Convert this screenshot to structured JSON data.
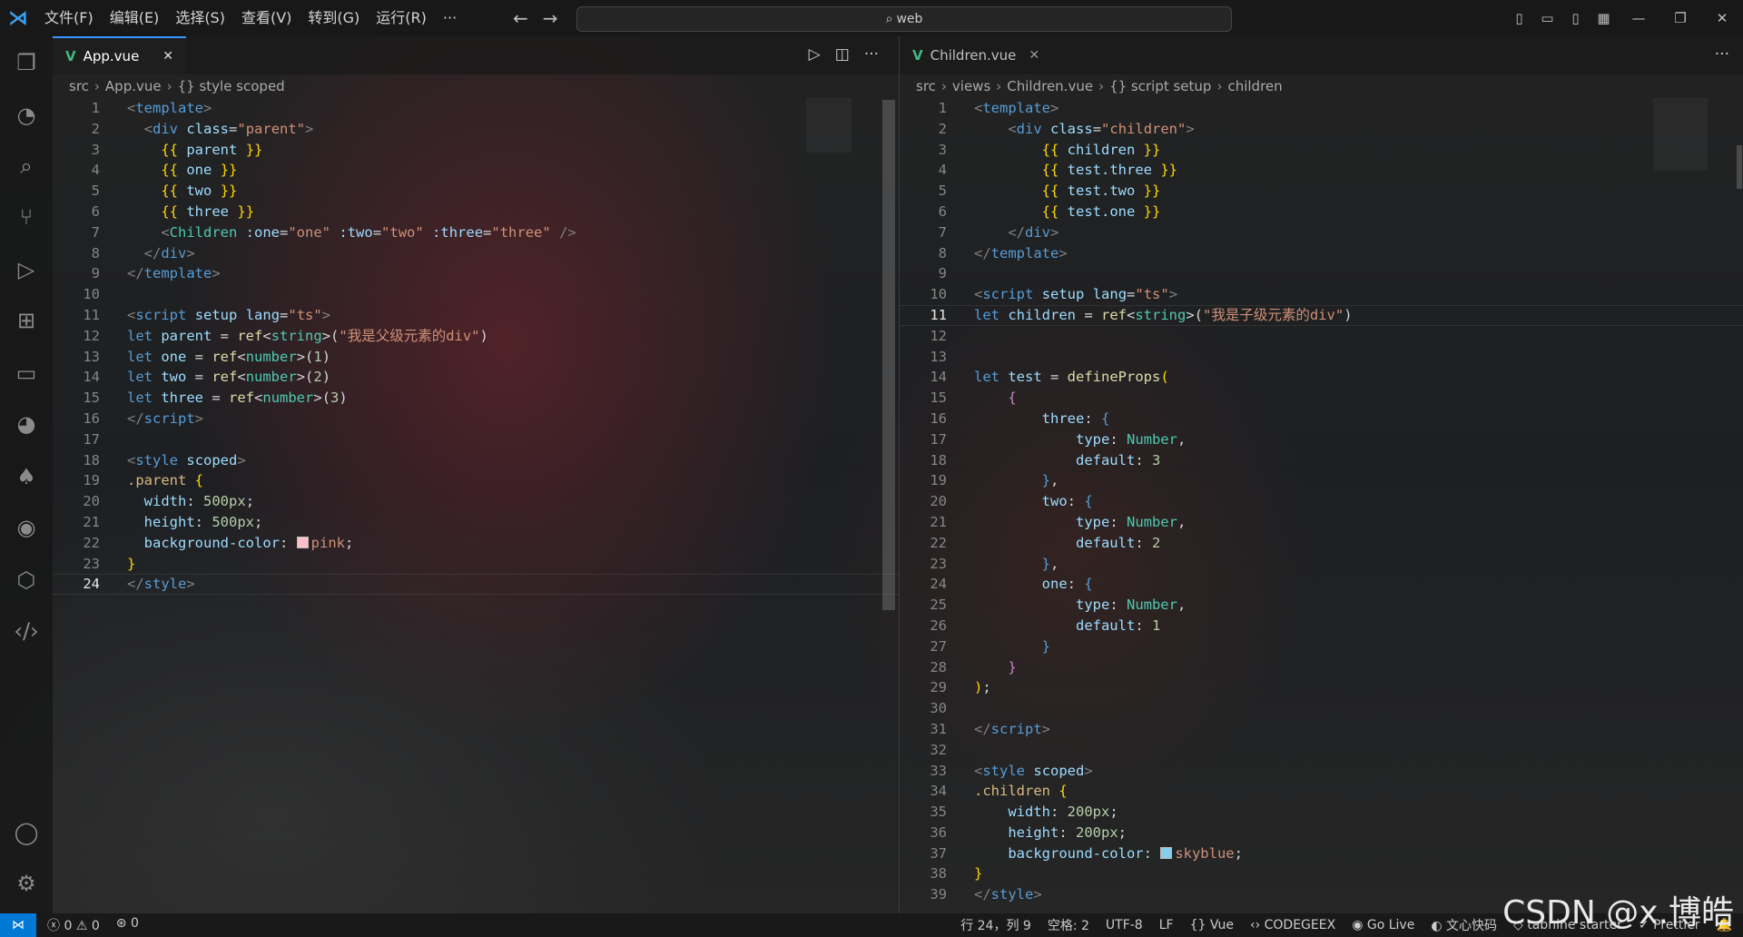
{
  "app": {
    "logo": "vscode-logo-icon"
  },
  "menu": [
    "文件(F)",
    "编辑(E)",
    "选择(S)",
    "查看(V)",
    "转到(G)",
    "运行(R)",
    "···"
  ],
  "search": {
    "text": "web"
  },
  "left_editor": {
    "tab": {
      "label": "App.vue",
      "close": "✕"
    },
    "breadcrumb": [
      "src",
      "App.vue",
      "{} style scoped"
    ],
    "current_line": 24,
    "lines": [
      [
        [
          "t-tag",
          "<"
        ],
        [
          "t-el",
          "template"
        ],
        [
          "t-tag",
          ">"
        ]
      ],
      [
        [
          "t-plain",
          "  "
        ],
        [
          "t-tag",
          "<"
        ],
        [
          "t-el",
          "div"
        ],
        [
          "t-plain",
          " "
        ],
        [
          "t-attr",
          "class"
        ],
        [
          "t-plain",
          "="
        ],
        [
          "t-str",
          "\"parent\""
        ],
        [
          "t-tag",
          ">"
        ]
      ],
      [
        [
          "t-plain",
          "    "
        ],
        [
          "t-brace",
          "{{"
        ],
        [
          "t-plain",
          " "
        ],
        [
          "t-var",
          "parent"
        ],
        [
          "t-plain",
          " "
        ],
        [
          "t-brace",
          "}}"
        ]
      ],
      [
        [
          "t-plain",
          "    "
        ],
        [
          "t-brace",
          "{{"
        ],
        [
          "t-plain",
          " "
        ],
        [
          "t-var",
          "one"
        ],
        [
          "t-plain",
          " "
        ],
        [
          "t-brace",
          "}}"
        ]
      ],
      [
        [
          "t-plain",
          "    "
        ],
        [
          "t-brace",
          "{{"
        ],
        [
          "t-plain",
          " "
        ],
        [
          "t-var",
          "two"
        ],
        [
          "t-plain",
          " "
        ],
        [
          "t-brace",
          "}}"
        ]
      ],
      [
        [
          "t-plain",
          "    "
        ],
        [
          "t-brace",
          "{{"
        ],
        [
          "t-plain",
          " "
        ],
        [
          "t-var",
          "three"
        ],
        [
          "t-plain",
          " "
        ],
        [
          "t-brace",
          "}}"
        ]
      ],
      [
        [
          "t-plain",
          "    "
        ],
        [
          "t-tag",
          "<"
        ],
        [
          "t-comp",
          "Children"
        ],
        [
          "t-plain",
          " "
        ],
        [
          "t-attr",
          ":one"
        ],
        [
          "t-plain",
          "="
        ],
        [
          "t-str",
          "\"one\""
        ],
        [
          "t-plain",
          " "
        ],
        [
          "t-attr",
          ":two"
        ],
        [
          "t-plain",
          "="
        ],
        [
          "t-str",
          "\"two\""
        ],
        [
          "t-plain",
          " "
        ],
        [
          "t-attr",
          ":three"
        ],
        [
          "t-plain",
          "="
        ],
        [
          "t-str",
          "\"three\""
        ],
        [
          "t-plain",
          " "
        ],
        [
          "t-tag",
          "/>"
        ]
      ],
      [
        [
          "t-plain",
          "  "
        ],
        [
          "t-tag",
          "</"
        ],
        [
          "t-el",
          "div"
        ],
        [
          "t-tag",
          ">"
        ]
      ],
      [
        [
          "t-tag",
          "</"
        ],
        [
          "t-el",
          "template"
        ],
        [
          "t-tag",
          ">"
        ]
      ],
      [],
      [
        [
          "t-tag",
          "<"
        ],
        [
          "t-el",
          "script"
        ],
        [
          "t-plain",
          " "
        ],
        [
          "t-attr",
          "setup"
        ],
        [
          "t-plain",
          " "
        ],
        [
          "t-attr",
          "lang"
        ],
        [
          "t-plain",
          "="
        ],
        [
          "t-str",
          "\"ts\""
        ],
        [
          "t-tag",
          ">"
        ]
      ],
      [
        [
          "t-kw",
          "let"
        ],
        [
          "t-plain",
          " "
        ],
        [
          "t-var",
          "parent"
        ],
        [
          "t-plain",
          " = "
        ],
        [
          "t-fn",
          "ref"
        ],
        [
          "t-plain",
          "<"
        ],
        [
          "t-type",
          "string"
        ],
        [
          "t-plain",
          ">("
        ],
        [
          "t-str",
          "\"我是父级元素的div\""
        ],
        [
          "t-plain",
          ")"
        ]
      ],
      [
        [
          "t-kw",
          "let"
        ],
        [
          "t-plain",
          " "
        ],
        [
          "t-var",
          "one"
        ],
        [
          "t-plain",
          " = "
        ],
        [
          "t-fn",
          "ref"
        ],
        [
          "t-plain",
          "<"
        ],
        [
          "t-type",
          "number"
        ],
        [
          "t-plain",
          ">("
        ],
        [
          "t-num",
          "1"
        ],
        [
          "t-plain",
          ")"
        ]
      ],
      [
        [
          "t-kw",
          "let"
        ],
        [
          "t-plain",
          " "
        ],
        [
          "t-var",
          "two"
        ],
        [
          "t-plain",
          " = "
        ],
        [
          "t-fn",
          "ref"
        ],
        [
          "t-plain",
          "<"
        ],
        [
          "t-type",
          "number"
        ],
        [
          "t-plain",
          ">("
        ],
        [
          "t-num",
          "2"
        ],
        [
          "t-plain",
          ")"
        ]
      ],
      [
        [
          "t-kw",
          "let"
        ],
        [
          "t-plain",
          " "
        ],
        [
          "t-var",
          "three"
        ],
        [
          "t-plain",
          " = "
        ],
        [
          "t-fn",
          "ref"
        ],
        [
          "t-plain",
          "<"
        ],
        [
          "t-type",
          "number"
        ],
        [
          "t-plain",
          ">("
        ],
        [
          "t-num",
          "3"
        ],
        [
          "t-plain",
          ")"
        ]
      ],
      [
        [
          "t-tag",
          "</"
        ],
        [
          "t-el",
          "script"
        ],
        [
          "t-tag",
          ">"
        ]
      ],
      [],
      [
        [
          "t-tag",
          "<"
        ],
        [
          "t-el",
          "style"
        ],
        [
          "t-plain",
          " "
        ],
        [
          "t-attr",
          "scoped"
        ],
        [
          "t-tag",
          ">"
        ]
      ],
      [
        [
          "t-cls",
          ".parent"
        ],
        [
          "t-plain",
          " "
        ],
        [
          "t-brace",
          "{"
        ]
      ],
      [
        [
          "t-plain",
          "  "
        ],
        [
          "t-attr",
          "width"
        ],
        [
          "t-plain",
          ": "
        ],
        [
          "t-num",
          "500px"
        ],
        [
          "t-plain",
          ";"
        ]
      ],
      [
        [
          "t-plain",
          "  "
        ],
        [
          "t-attr",
          "height"
        ],
        [
          "t-plain",
          ": "
        ],
        [
          "t-num",
          "500px"
        ],
        [
          "t-plain",
          ";"
        ]
      ],
      [
        [
          "t-plain",
          "  "
        ],
        [
          "t-attr",
          "background-color"
        ],
        [
          "t-plain",
          ": "
        ],
        [
          "swatch",
          "#ffc0cb"
        ],
        [
          "t-str",
          "pink"
        ],
        [
          "t-plain",
          ";"
        ]
      ],
      [
        [
          "t-brace",
          "}"
        ]
      ],
      [
        [
          "t-tag",
          "</"
        ],
        [
          "t-el",
          "style"
        ],
        [
          "t-tag",
          ">"
        ]
      ]
    ]
  },
  "right_editor": {
    "tab": {
      "label": "Children.vue",
      "close": "✕"
    },
    "breadcrumb": [
      "src",
      "views",
      "Children.vue",
      "{} script setup",
      "children"
    ],
    "current_line": 11,
    "lines": [
      [
        [
          "t-tag",
          "<"
        ],
        [
          "t-el",
          "template"
        ],
        [
          "t-tag",
          ">"
        ]
      ],
      [
        [
          "t-plain",
          "    "
        ],
        [
          "t-tag",
          "<"
        ],
        [
          "t-el",
          "div"
        ],
        [
          "t-plain",
          " "
        ],
        [
          "t-attr",
          "class"
        ],
        [
          "t-plain",
          "="
        ],
        [
          "t-str",
          "\"children\""
        ],
        [
          "t-tag",
          ">"
        ]
      ],
      [
        [
          "t-plain",
          "        "
        ],
        [
          "t-brace",
          "{{"
        ],
        [
          "t-plain",
          " "
        ],
        [
          "t-var",
          "children"
        ],
        [
          "t-plain",
          " "
        ],
        [
          "t-brace",
          "}}"
        ]
      ],
      [
        [
          "t-plain",
          "        "
        ],
        [
          "t-brace",
          "{{"
        ],
        [
          "t-plain",
          " "
        ],
        [
          "t-var",
          "test.three"
        ],
        [
          "t-plain",
          " "
        ],
        [
          "t-brace",
          "}}"
        ]
      ],
      [
        [
          "t-plain",
          "        "
        ],
        [
          "t-brace",
          "{{"
        ],
        [
          "t-plain",
          " "
        ],
        [
          "t-var",
          "test.two"
        ],
        [
          "t-plain",
          " "
        ],
        [
          "t-brace",
          "}}"
        ]
      ],
      [
        [
          "t-plain",
          "        "
        ],
        [
          "t-brace",
          "{{"
        ],
        [
          "t-plain",
          " "
        ],
        [
          "t-var",
          "test.one"
        ],
        [
          "t-plain",
          " "
        ],
        [
          "t-brace",
          "}}"
        ]
      ],
      [
        [
          "t-plain",
          "    "
        ],
        [
          "t-tag",
          "</"
        ],
        [
          "t-el",
          "div"
        ],
        [
          "t-tag",
          ">"
        ]
      ],
      [
        [
          "t-tag",
          "</"
        ],
        [
          "t-el",
          "template"
        ],
        [
          "t-tag",
          ">"
        ]
      ],
      [],
      [
        [
          "t-tag",
          "<"
        ],
        [
          "t-el",
          "script"
        ],
        [
          "t-plain",
          " "
        ],
        [
          "t-attr",
          "setup"
        ],
        [
          "t-plain",
          " "
        ],
        [
          "t-attr",
          "lang"
        ],
        [
          "t-plain",
          "="
        ],
        [
          "t-str",
          "\"ts\""
        ],
        [
          "t-tag",
          ">"
        ]
      ],
      [
        [
          "t-kw",
          "let"
        ],
        [
          "t-plain",
          " "
        ],
        [
          "t-var",
          "children"
        ],
        [
          "t-plain",
          " = "
        ],
        [
          "t-fn",
          "ref"
        ],
        [
          "t-plain",
          "<"
        ],
        [
          "t-type",
          "string"
        ],
        [
          "t-plain",
          ">("
        ],
        [
          "t-str",
          "\"我是子级元素的div\""
        ],
        [
          "t-plain",
          ")"
        ]
      ],
      [],
      [],
      [
        [
          "t-kw",
          "let"
        ],
        [
          "t-plain",
          " "
        ],
        [
          "t-var",
          "test"
        ],
        [
          "t-plain",
          " = "
        ],
        [
          "t-fn",
          "defineProps"
        ],
        [
          "t-brace",
          "("
        ]
      ],
      [
        [
          "t-plain",
          "    "
        ],
        [
          "t-purple",
          "{"
        ]
      ],
      [
        [
          "t-plain",
          "        "
        ],
        [
          "t-var",
          "three"
        ],
        [
          "t-plain",
          ": "
        ],
        [
          "t-el",
          "{"
        ]
      ],
      [
        [
          "t-plain",
          "            "
        ],
        [
          "t-var",
          "type"
        ],
        [
          "t-plain",
          ": "
        ],
        [
          "t-type",
          "Number"
        ],
        [
          "t-plain",
          ","
        ]
      ],
      [
        [
          "t-plain",
          "            "
        ],
        [
          "t-var",
          "default"
        ],
        [
          "t-plain",
          ": "
        ],
        [
          "t-num",
          "3"
        ]
      ],
      [
        [
          "t-plain",
          "        "
        ],
        [
          "t-el",
          "}"
        ],
        [
          "t-plain",
          ","
        ]
      ],
      [
        [
          "t-plain",
          "        "
        ],
        [
          "t-var",
          "two"
        ],
        [
          "t-plain",
          ": "
        ],
        [
          "t-el",
          "{"
        ]
      ],
      [
        [
          "t-plain",
          "            "
        ],
        [
          "t-var",
          "type"
        ],
        [
          "t-plain",
          ": "
        ],
        [
          "t-type",
          "Number"
        ],
        [
          "t-plain",
          ","
        ]
      ],
      [
        [
          "t-plain",
          "            "
        ],
        [
          "t-var",
          "default"
        ],
        [
          "t-plain",
          ": "
        ],
        [
          "t-num",
          "2"
        ]
      ],
      [
        [
          "t-plain",
          "        "
        ],
        [
          "t-el",
          "}"
        ],
        [
          "t-plain",
          ","
        ]
      ],
      [
        [
          "t-plain",
          "        "
        ],
        [
          "t-var",
          "one"
        ],
        [
          "t-plain",
          ": "
        ],
        [
          "t-el",
          "{"
        ]
      ],
      [
        [
          "t-plain",
          "            "
        ],
        [
          "t-var",
          "type"
        ],
        [
          "t-plain",
          ": "
        ],
        [
          "t-type",
          "Number"
        ],
        [
          "t-plain",
          ","
        ]
      ],
      [
        [
          "t-plain",
          "            "
        ],
        [
          "t-var",
          "default"
        ],
        [
          "t-plain",
          ": "
        ],
        [
          "t-num",
          "1"
        ]
      ],
      [
        [
          "t-plain",
          "        "
        ],
        [
          "t-el",
          "}"
        ]
      ],
      [
        [
          "t-plain",
          "    "
        ],
        [
          "t-purple",
          "}"
        ]
      ],
      [
        [
          "t-brace",
          ")"
        ],
        [
          "t-plain",
          ";"
        ]
      ],
      [],
      [
        [
          "t-tag",
          "</"
        ],
        [
          "t-el",
          "script"
        ],
        [
          "t-tag",
          ">"
        ]
      ],
      [],
      [
        [
          "t-tag",
          "<"
        ],
        [
          "t-el",
          "style"
        ],
        [
          "t-plain",
          " "
        ],
        [
          "t-attr",
          "scoped"
        ],
        [
          "t-tag",
          ">"
        ]
      ],
      [
        [
          "t-cls",
          ".children"
        ],
        [
          "t-plain",
          " "
        ],
        [
          "t-brace",
          "{"
        ]
      ],
      [
        [
          "t-plain",
          "    "
        ],
        [
          "t-attr",
          "width"
        ],
        [
          "t-plain",
          ": "
        ],
        [
          "t-num",
          "200px"
        ],
        [
          "t-plain",
          ";"
        ]
      ],
      [
        [
          "t-plain",
          "    "
        ],
        [
          "t-attr",
          "height"
        ],
        [
          "t-plain",
          ": "
        ],
        [
          "t-num",
          "200px"
        ],
        [
          "t-plain",
          ";"
        ]
      ],
      [
        [
          "t-plain",
          "    "
        ],
        [
          "t-attr",
          "background-color"
        ],
        [
          "t-plain",
          ": "
        ],
        [
          "swatch",
          "#87ceeb"
        ],
        [
          "t-str",
          "skyblue"
        ],
        [
          "t-plain",
          ";"
        ]
      ],
      [
        [
          "t-brace",
          "}"
        ]
      ],
      [
        [
          "t-tag",
          "</"
        ],
        [
          "t-el",
          "style"
        ],
        [
          "t-tag",
          ">"
        ]
      ]
    ]
  },
  "statusbar": {
    "remote_icon": "remote-icon",
    "errors": "0",
    "warnings": "0",
    "ports": "0",
    "position": "行 24，列 9",
    "spaces": "空格: 2",
    "encoding": "UTF-8",
    "eol": "LF",
    "language": "Vue",
    "codegeex": "CODEGEEX",
    "golive": "Go Live",
    "wenxin": "文心快码",
    "tabnine": "tabnine starter",
    "prettier": "Prettier"
  },
  "watermark": "CSDN @x.博皓"
}
